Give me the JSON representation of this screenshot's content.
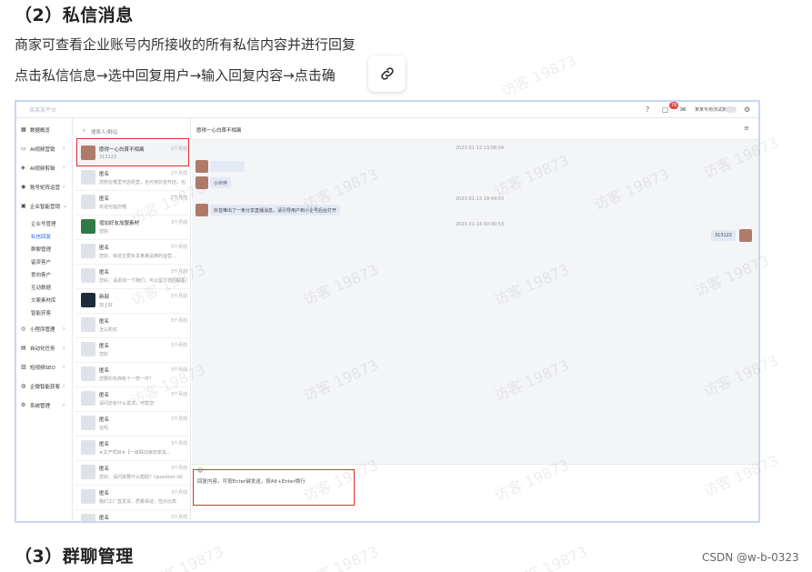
{
  "article": {
    "section2_heading": "（2）私信消息",
    "para1": "商家可查看企业账号内所接收的所有私信内容并进行回复",
    "para2": "点击私信信息→选中回复用户→输入回复内容→点击确",
    "section3_heading": "（3）群聊管理",
    "credit": "CSDN @w-b-0323",
    "watermark": "访客 19873"
  },
  "topbar": {
    "logo": "某某某平台",
    "notif_count": "76",
    "account": "某某专用测试账号"
  },
  "sidebar": {
    "items": [
      {
        "icon": "dashboard-icon",
        "glyph": "▦",
        "label": "数据概览",
        "arrow": ""
      },
      {
        "icon": "video-icon",
        "glyph": "▭",
        "label": "AI视频营销",
        "arrow": "›"
      },
      {
        "icon": "clip-icon",
        "glyph": "◈",
        "label": "AI视频剪辑",
        "arrow": "›"
      },
      {
        "icon": "account-icon",
        "glyph": "◉",
        "label": "账号矩阵运营",
        "arrow": "›"
      },
      {
        "icon": "enterprise-icon",
        "glyph": "▣",
        "label": "企业智能营销",
        "arrow": "⌄"
      }
    ],
    "sub_items": [
      "企业号管理",
      "私信回复",
      "群聊管理",
      "留资客户",
      "意向客户",
      "互动数据",
      "文案素材库",
      "智能获客"
    ],
    "more_items": [
      {
        "icon": "miniapp-icon",
        "glyph": "◎",
        "label": "小程序管理",
        "arrow": "›"
      },
      {
        "icon": "tasks-icon",
        "glyph": "▤",
        "label": "自动化任务",
        "arrow": "›"
      },
      {
        "icon": "seo-icon",
        "glyph": "▥",
        "label": "短视频SEO",
        "arrow": "›"
      },
      {
        "icon": "wecom-icon",
        "glyph": "◍",
        "label": "企微智能获客",
        "arrow": "›"
      },
      {
        "icon": "settings-icon",
        "glyph": "⚙",
        "label": "系统管理",
        "arrow": "›"
      }
    ]
  },
  "conversations": {
    "search_placeholder": "搜索人/群站",
    "items": [
      {
        "name": "愿得一心白首不相离",
        "msg": "313123",
        "time": "2个月前",
        "avatar": "photo"
      },
      {
        "name": "匿名",
        "msg": "您想在哪里开店经营，也可用抖音开店，也...",
        "time": "2个月前",
        "avatar": "gray"
      },
      {
        "name": "匿名",
        "msg": "欢迎光临您哦",
        "time": "2个月前",
        "avatar": "gray"
      },
      {
        "name": "增加好友加盟素材",
        "msg": "您好",
        "time": "3个月前",
        "avatar": "green"
      },
      {
        "name": "匿名",
        "msg": "您好，目前主要负责某某品牌的运营...",
        "time": "3个月前",
        "avatar": "gray"
      },
      {
        "name": "匿名",
        "msg": "您好，请添加一下我们，可以留下您的联系方...",
        "time": "3个月前",
        "avatar": "gray"
      },
      {
        "name": "新部",
        "msg": "加上好",
        "time": "3个月前",
        "avatar": "black"
      },
      {
        "name": "匿名",
        "msg": "怎么购买",
        "time": "3个月前",
        "avatar": "gray"
      },
      {
        "name": "匿名",
        "msg": "您好",
        "time": "3个月前",
        "avatar": "gray"
      },
      {
        "name": "匿名",
        "msg": "您要的东西有个一样一件？",
        "time": "3个月前",
        "avatar": "gray"
      },
      {
        "name": "匿名",
        "msg": "请问您有什么需求，可帮您",
        "time": "3个月前",
        "avatar": "gray"
      },
      {
        "name": "匿名",
        "msg": "在吗",
        "time": "3个月前",
        "avatar": "gray"
      },
      {
        "name": "匿名",
        "msg": "★文产项目★【一级联动家纺家具...",
        "time": "3个月前",
        "avatar": "gray"
      },
      {
        "name": "匿名",
        "msg": "您好，请问需要什么帮助？(question-id)",
        "time": "3个月前",
        "avatar": "gray"
      },
      {
        "name": "匿名",
        "msg": "我们工厂直发货，质量保证，性价比高",
        "time": "3个月前",
        "avatar": "gray"
      },
      {
        "name": "匿名",
        "msg": "",
        "time": "3个月前",
        "avatar": "gray"
      }
    ]
  },
  "chat": {
    "title": "愿得一心白首不相离",
    "menu_icon": "≡",
    "timestamps": [
      "2023-01-12 13:08:54",
      "2023-01-13 19:49:03",
      "2023-01-14 00:00:53"
    ],
    "messages": [
      {
        "side": "left",
        "text": ""
      },
      {
        "side": "left",
        "text": "小伙伴"
      },
      {
        "side": "left",
        "text": "抖音推出了一条分享直播消息，请引导用户到小企号后台打开"
      },
      {
        "side": "right",
        "text": "313122"
      }
    ],
    "input_placeholder": "回复内容，可按Enter键发送，按Alt+Enter换行"
  }
}
